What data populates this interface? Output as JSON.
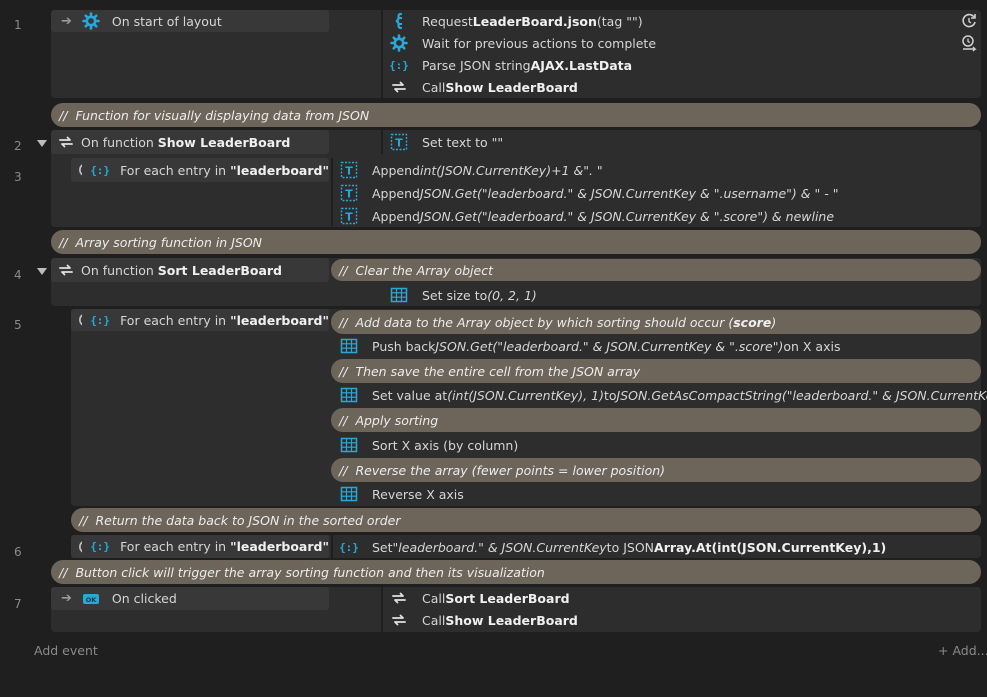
{
  "events": [
    {
      "number": "1",
      "condition": "On start of layout",
      "actions": [
        {
          "pre": "Request ",
          "bold": "LeaderBoard.json",
          "post": " (tag \"\")"
        },
        {
          "pre": "Wait for previous actions to complete"
        },
        {
          "pre": "Parse JSON string ",
          "bold": "AJAX.LastData"
        },
        {
          "pre": "Call ",
          "bold": "Show LeaderBoard"
        }
      ]
    },
    {
      "number": "2",
      "condition_pre": "On function ",
      "condition_bold": "Show LeaderBoard",
      "actions": [
        {
          "pre": "Set text to \"\""
        }
      ]
    },
    {
      "number": "3",
      "condition_pre": "For each entry in ",
      "condition_bold": "\"leaderboard\"",
      "actions": [
        {
          "pre": "Append ",
          "ital": "int(JSON.CurrentKey)+1 &\". \""
        },
        {
          "pre": "Append ",
          "ital": "JSON.Get(\"leaderboard.\" & JSON.CurrentKey & \".username\") & \" - \""
        },
        {
          "pre": "Append ",
          "ital": "JSON.Get(\"leaderboard.\" & JSON.CurrentKey & \".score\") & newline"
        }
      ]
    },
    {
      "number": "4",
      "condition_pre": "On function ",
      "condition_bold": "Sort LeaderBoard",
      "actions": [
        {
          "pre": "Set size to ",
          "ital": "(0, 2, 1)"
        }
      ]
    },
    {
      "number": "5",
      "condition_pre": "For each entry in ",
      "condition_bold": "\"leaderboard\"",
      "actions": [
        {
          "pre": "Push back ",
          "ital": "JSON.Get(\"leaderboard.\" & JSON.CurrentKey & \".score\")",
          "post": " on X axis"
        },
        {
          "pre": "Set value at ",
          "ital": "(int(JSON.CurrentKey), 1)",
          "post": " to ",
          "ital2": "JSON.GetAsCompactString(\"leaderboard.\" & JSON.CurrentKey)"
        },
        {
          "pre": "Sort X axis (by column)"
        },
        {
          "pre": "Reverse X axis"
        }
      ]
    },
    {
      "number": "6",
      "condition_pre": "For each entry in ",
      "condition_bold": "\"leaderboard\"",
      "actions": [
        {
          "pre": "Set ",
          "ital": "\"leaderboard.\" & JSON.CurrentKey",
          "post": " to JSON ",
          "bold": "Array.At(int(JSON.CurrentKey),1)"
        }
      ]
    },
    {
      "number": "7",
      "condition": "On clicked",
      "actions": [
        {
          "pre": "Call ",
          "bold": "Sort LeaderBoard"
        },
        {
          "pre": "Call ",
          "bold": "Show LeaderBoard"
        }
      ]
    }
  ],
  "comments": {
    "c1": "Function for visually displaying data from JSON",
    "c2": "Array sorting function in JSON",
    "c3": "Clear the Array object",
    "c4_pre": "Add data to the Array object by which sorting should occur (",
    "c4_bold": "score",
    "c4_post": ")",
    "c5": "Then save the entire cell from the JSON array",
    "c6": "Apply sorting",
    "c7": "Reverse the array (fewer points = lower position)",
    "c8": "Return the data back to JSON in the sorted order",
    "c9": "Button click will trigger the array sorting function and then its visualization",
    "slash": "//"
  },
  "footer": {
    "add_event": "Add event",
    "add": "+ Add..."
  },
  "icons": {
    "ajax": "ajax-icon",
    "system": "gear-icon",
    "json": "json-icon",
    "function": "function-icon",
    "text": "text-object-icon",
    "array": "array-grid-icon",
    "loop": "loop-icon",
    "button": "button-object-icon"
  },
  "colors": {
    "accent": "#27a8d8",
    "comment": "#6d655a",
    "block": "#2d2d2d",
    "background": "#1f1f1f"
  }
}
